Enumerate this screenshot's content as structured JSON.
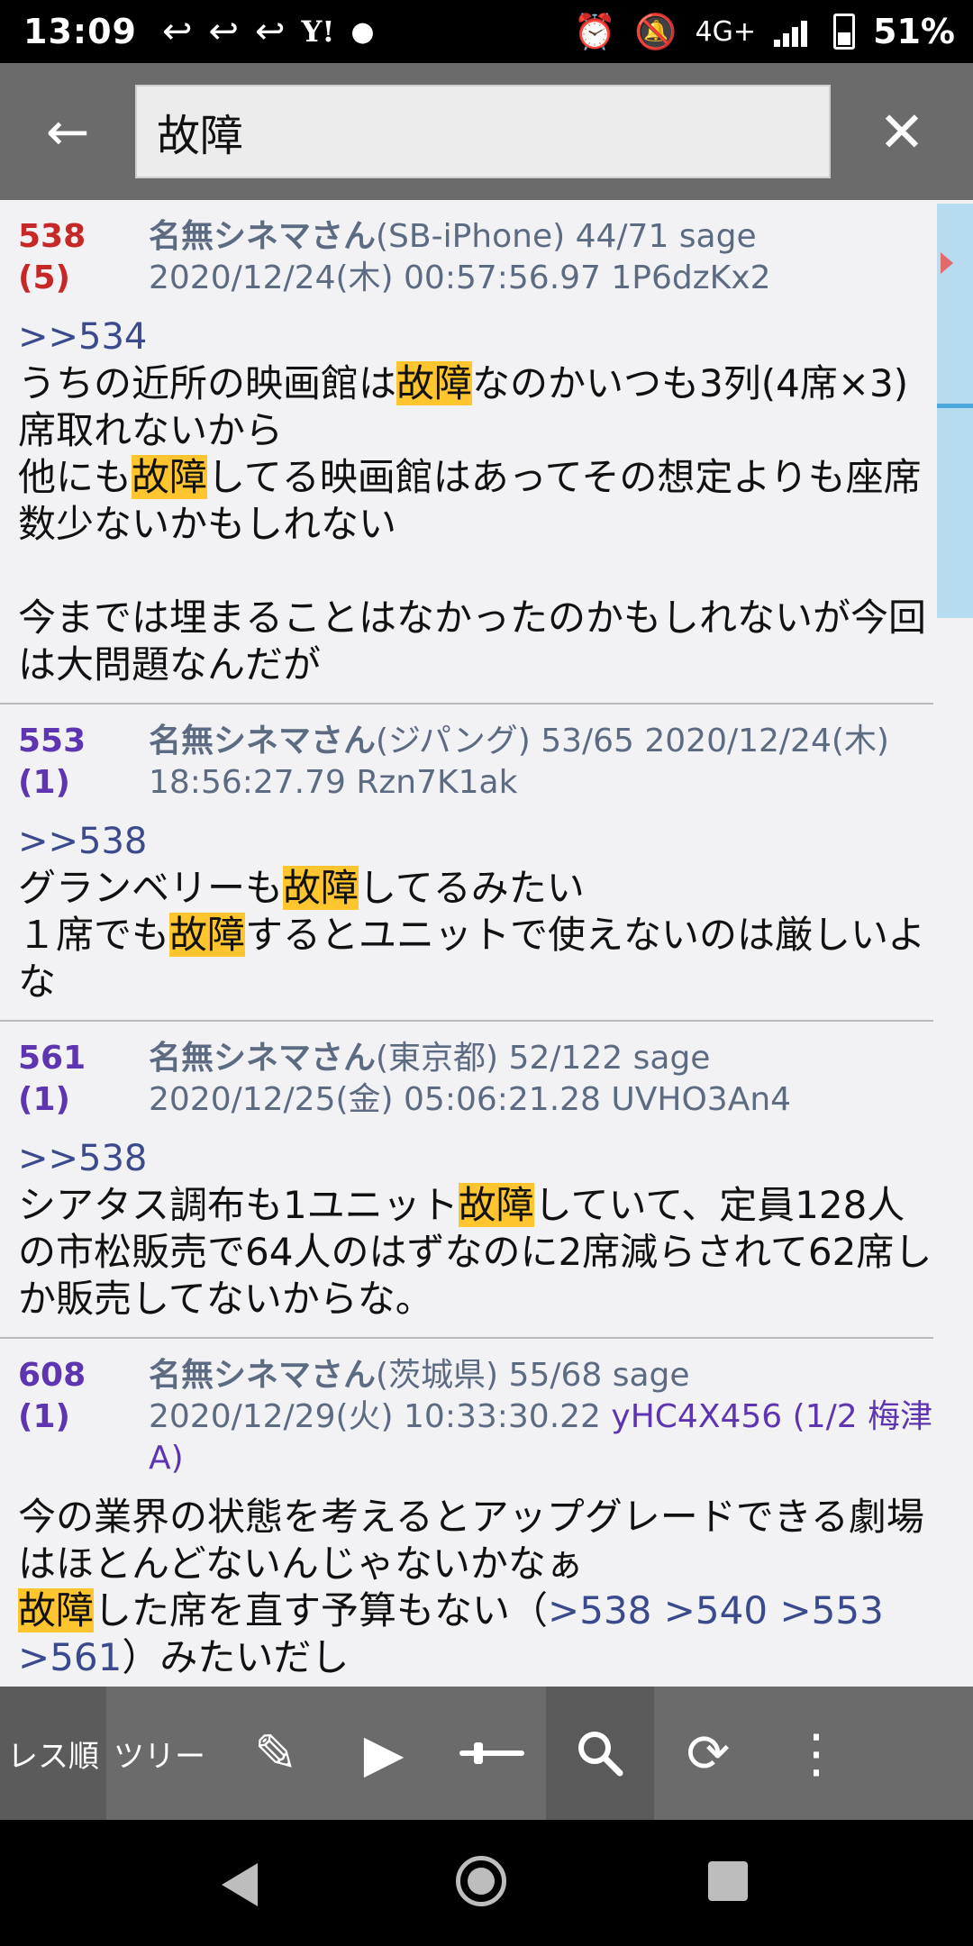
{
  "status_bar": {
    "time": "13:09",
    "left_icons": [
      "reply-arrow-icon",
      "reply-arrow-icon",
      "reply-arrow-icon",
      "yahoo-icon",
      "dot-icon"
    ],
    "yahoo_text": "Y!",
    "network": "4G+",
    "battery": "51%"
  },
  "search": {
    "query": "故障",
    "back_icon": "←",
    "clear_icon": "✕"
  },
  "highlight_color": "#ffc52e",
  "posts": [
    {
      "num": "538 (5)",
      "name": "名無シネマさん",
      "meta1": "(SB-iPhone) 44/71 sage",
      "meta2": "2020/12/24(木) 00:57:56.97 1P6dzKx2",
      "reply": ">>534",
      "body": [
        [
          "うちの近所の映画館は",
          "故障",
          "なのかいつも3列(4席×3)席取れないから"
        ],
        [
          "他にも",
          "故障",
          "してる映画館はあってその想定よりも座席数少ないかもしれない"
        ],
        [
          "今までは埋まることはなかったのかもしれないが今回は大問題なんだが"
        ]
      ]
    },
    {
      "num": "553 (1)",
      "name": "名無シネマさん",
      "meta1": "(ジパング) 53/65  2020/12/24(木)",
      "meta2": "18:56:27.79 Rzn7K1ak",
      "reply": ">>538",
      "body": [
        [
          "グランベリーも",
          "故障",
          "してるみたい"
        ],
        [
          "１席でも",
          "故障",
          "するとユニットで使えないのは厳しいよな"
        ]
      ]
    },
    {
      "num": "561 (1)",
      "name": "名無シネマさん",
      "meta1": "(東京都) 52/122 sage",
      "meta2": "2020/12/25(金) 05:06:21.28 UVHO3An4",
      "reply": ">>538",
      "body": [
        [
          "シアタス調布も1ユニット",
          "故障",
          "していて、定員128人の市松販売で64人のはずなのに2席減らされて62席しか販売してないからな。"
        ]
      ]
    },
    {
      "num": "608 (1)",
      "name": "名無シネマさん",
      "meta1": "(茨城県) 55/68 sage",
      "meta2": "2020/12/29(火) 10:33:30.22",
      "id_extra": "yHC4X456 (1/2 梅津A)",
      "body_a": "今の業界の状態を考えるとアップグレードできる劇場はほとんどないんじゃないかなぁ",
      "body_b_hl": "故障",
      "body_b": "した席を直す予算もない（",
      "body_b_links": ">538 >540 >553 >561",
      "body_b_tail": "）みたいだし"
    }
  ],
  "toolbar": {
    "tab_res": "レス順",
    "tab_tree": "ツリー",
    "icons": [
      "pencil-icon",
      "play-icon",
      "slider-icon",
      "search-icon",
      "refresh-icon",
      "more-icon"
    ]
  }
}
